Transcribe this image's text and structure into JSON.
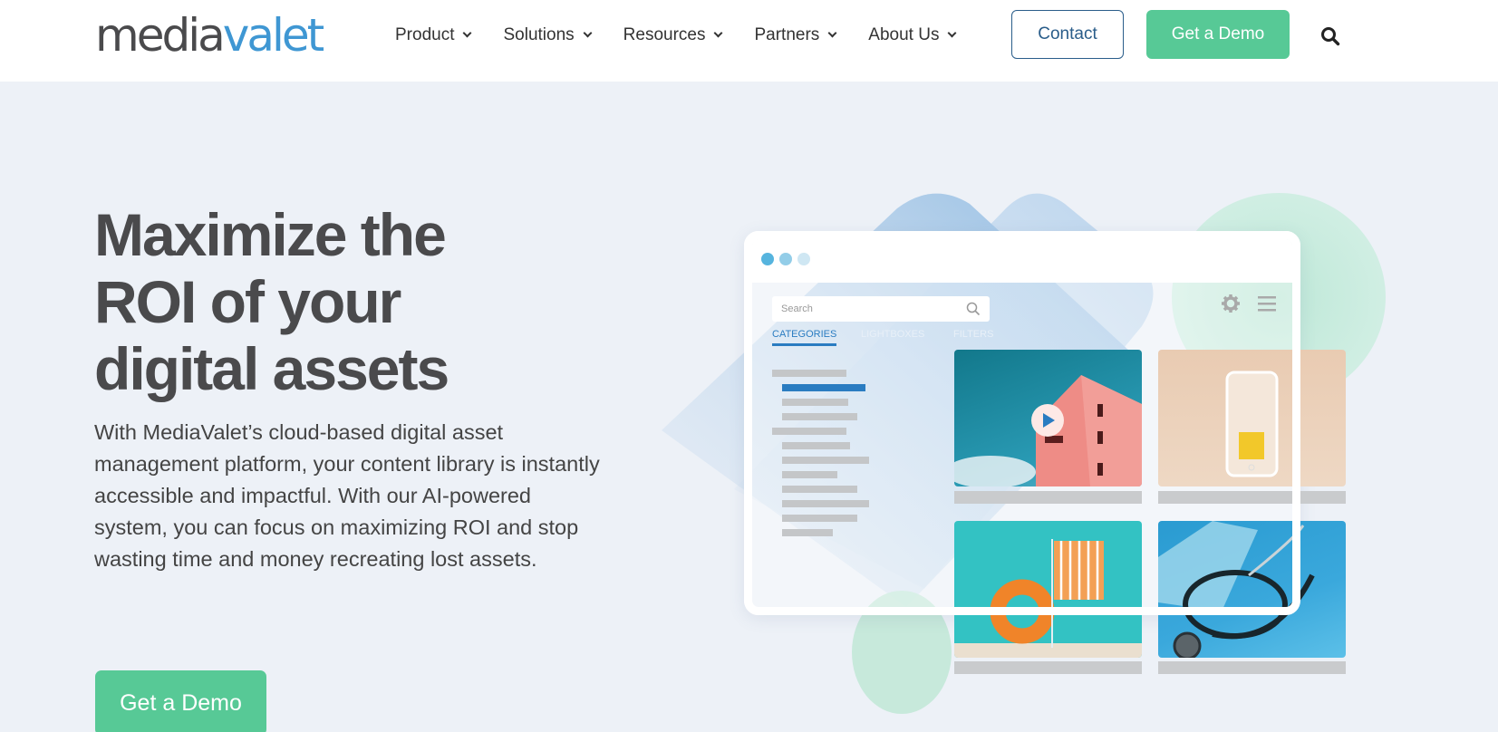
{
  "header": {
    "logo": {
      "part1": "media",
      "part2": "valet"
    },
    "nav": [
      {
        "label": "Product"
      },
      {
        "label": "Solutions"
      },
      {
        "label": "Resources"
      },
      {
        "label": "Partners"
      },
      {
        "label": "About Us"
      }
    ],
    "contact_label": "Contact",
    "demo_label": "Get a Demo",
    "search_icon": "search-icon"
  },
  "hero": {
    "headline": [
      "Maximize the",
      "ROI of your",
      "digital assets"
    ],
    "subtext": "With MediaValet’s cloud-based digital asset management platform, your content library is instantly accessible and impactful. With our AI-powered system, you can focus on maximizing ROI and stop wasting time and money recreating lost assets.",
    "cta_label": "Get a Demo"
  },
  "illustration": {
    "search_placeholder": "Search",
    "tabs": [
      {
        "label": "CATEGORIES",
        "active": true
      },
      {
        "label": "LIGHTBOXES",
        "active": false
      },
      {
        "label": "FILTERS",
        "active": false
      }
    ],
    "icons": [
      "gear-icon",
      "menu-icon",
      "play-icon"
    ],
    "thumbnails": [
      "pink-building-video",
      "phone-shopping-bag",
      "beach-chair-lifebuoy",
      "stethoscope-mask"
    ]
  },
  "colors": {
    "brand_dark": "#4a4a4c",
    "brand_blue": "#3f97d3",
    "cta_green": "#57c996",
    "contact_border": "#2a5d8a",
    "page_bg": "#edf1f7",
    "active_tab": "#2a7cc1"
  }
}
